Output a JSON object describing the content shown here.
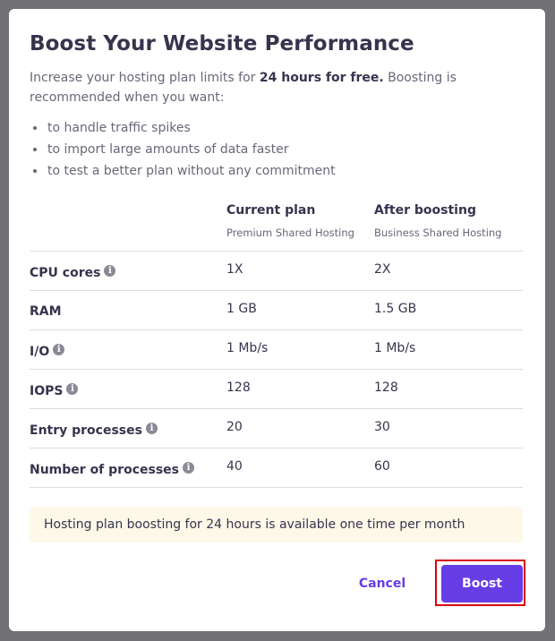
{
  "modal": {
    "title": "Boost Your Website Performance",
    "intro_prefix": "Increase your hosting plan limits for ",
    "intro_bold": "24 hours for free.",
    "intro_suffix": " Boosting is recommended when you want:",
    "bullets": [
      "to handle traffic spikes",
      "to import large amounts of data faster",
      "to test a better plan without any commitment"
    ]
  },
  "table": {
    "columns": [
      {
        "title": "Current plan",
        "subtitle": "Premium Shared Hosting"
      },
      {
        "title": "After boosting",
        "subtitle": "Business Shared Hosting"
      }
    ],
    "rows": [
      {
        "label": "CPU cores",
        "info": true,
        "current": "1X",
        "after": "2X"
      },
      {
        "label": "RAM",
        "info": false,
        "current": "1 GB",
        "after": "1.5 GB"
      },
      {
        "label": "I/O",
        "info": true,
        "current": "1 Mb/s",
        "after": "1 Mb/s"
      },
      {
        "label": "IOPS",
        "info": true,
        "current": "128",
        "after": "128"
      },
      {
        "label": "Entry processes",
        "info": true,
        "current": "20",
        "after": "30"
      },
      {
        "label": "Number of processes",
        "info": true,
        "current": "40",
        "after": "60"
      }
    ]
  },
  "notice": "Hosting plan boosting for 24 hours is available one time per month",
  "actions": {
    "cancel_label": "Cancel",
    "boost_label": "Boost"
  },
  "colors": {
    "accent": "#673de6",
    "highlight": "#d9000f",
    "notice_bg": "#fef8e9"
  },
  "icons": {
    "info": "info-circle-icon",
    "info_glyph": "i"
  }
}
